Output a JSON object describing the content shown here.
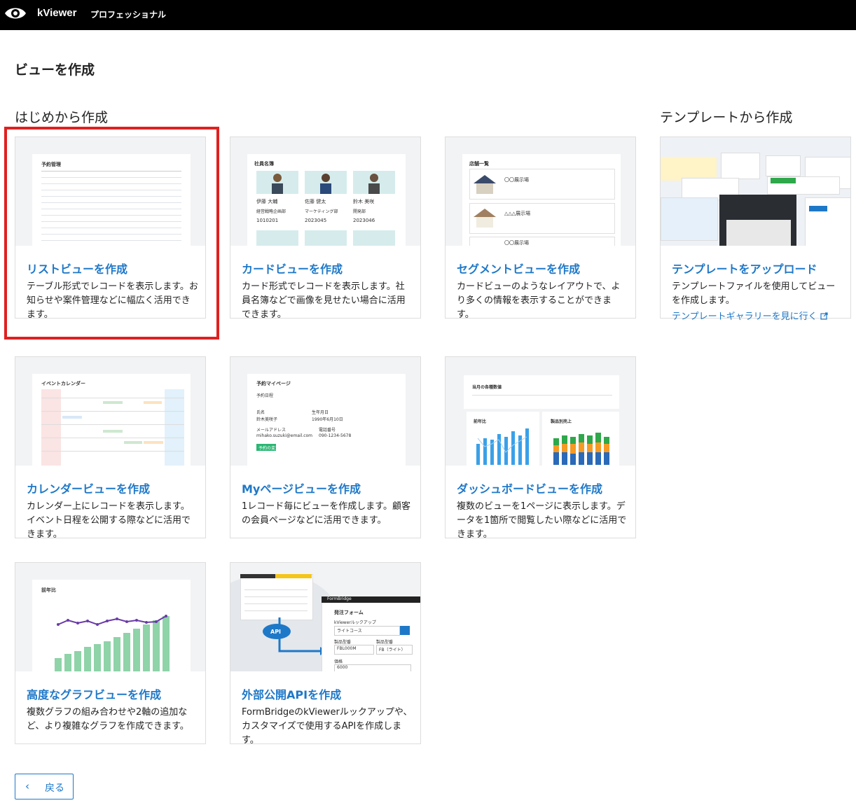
{
  "header": {
    "app_name": "kViewer",
    "edition": "プロフェッショナル"
  },
  "page": {
    "title": "ビューを作成"
  },
  "sections": {
    "scratch": "はじめから作成",
    "template": "テンプレートから作成"
  },
  "cards": [
    {
      "title": "リストビューを作成",
      "desc": "テーブル形式でレコードを表示します。お知らせや案件管理などに幅広く活用できます。",
      "thumb_label": "予約管理"
    },
    {
      "title": "カードビューを作成",
      "desc": "カード形式でレコードを表示します。社員名簿などで画像を見せたい場合に活用できます。",
      "thumb_label": "社員名簿",
      "thumb_items": [
        "伊藤 大輔",
        "佐藤 健太",
        "鈴木 美咲",
        "経営戦略企画部",
        "マーケティング部",
        "開発部",
        "1010201",
        "2023045",
        "2023046"
      ]
    },
    {
      "title": "セグメントビューを作成",
      "desc": "カードビューのようなレイアウトで、より多くの情報を表示することができます。",
      "thumb_label": "店舗一覧",
      "thumb_items": [
        "〇〇展示場",
        "△△△展示場",
        "〇〇展示場"
      ]
    },
    {
      "title": "テンプレートをアップロード",
      "desc": "テンプレートファイルを使用してビューを作成します。",
      "link": "テンプレートギャラリーを見に行く"
    },
    {
      "title": "カレンダービューを作成",
      "desc": "カレンダー上にレコードを表示します。イベント日程を公開する際などに活用できます。",
      "thumb_label": "イベントカレンダー"
    },
    {
      "title": "Myページビューを作成",
      "desc": "1レコード毎にビューを作成します。顧客の会員ページなどに活用できます。",
      "thumb_label": "予約マイページ",
      "thumb_items": [
        "予約日程",
        "氏名",
        "生年月日",
        "鈴木美咲子",
        "1990年6月10日",
        "メールアドレス",
        "電話番号",
        "mihako.suzuki@email.com",
        "090-1234-5678",
        "予約の変更"
      ]
    },
    {
      "title": "ダッシュボードビューを作成",
      "desc": "複数のビューを1ページに表示します。データを1箇所で閲覧したい際などに活用できます。",
      "thumb_label": "当月の各種数値",
      "thumb_items": [
        "前年比",
        "製品別売上"
      ]
    },
    {
      "title": "高度なグラフビューを作成",
      "desc": "複数グラフの組み合わせや2軸の追加など、より複雑なグラフを作成できます。",
      "thumb_label": "前年比"
    },
    {
      "title": "外部公開APIを作成",
      "desc": "FormBridgeのkViewerルックアップや、カスタマイズで使用するAPIを作成します。",
      "thumb_items": [
        "API",
        "FormBridge",
        "発注フォーム",
        "kViewerルックアップ",
        "ライトコース",
        "製品型番",
        "製品型番",
        "FBL000M",
        "FB（ライト）",
        "価格",
        "6000"
      ]
    }
  ],
  "footer": {
    "back_label": "戻る"
  },
  "colors": {
    "accent": "#1e78c8",
    "highlight": "#e02020",
    "topbar": "#000000"
  }
}
